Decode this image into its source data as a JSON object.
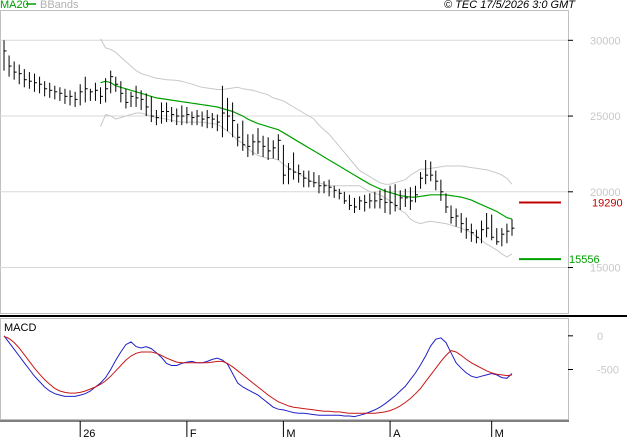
{
  "header": {
    "legend_ma": "MA20",
    "legend_bb": "BBands",
    "copyright": "© TEC 17/5/2026 3:0 GMT"
  },
  "colors": {
    "ma": "#00a000",
    "bbands": "#c8c8c8",
    "bars": "#000000",
    "grid": "#d8d8d8",
    "resistance": "#c00000",
    "support": "#00a000",
    "macd": "#2020c8",
    "signal": "#c81818"
  },
  "chart_data": [
    {
      "type": "line",
      "panel": "price",
      "ylim": [
        12000,
        32000
      ],
      "y_ticks": [
        15000,
        20000,
        25000,
        30000
      ],
      "y_tick_labels": [
        "15000",
        "20000",
        "25000",
        "30000"
      ],
      "x_ticks": [
        "26",
        "F",
        "M",
        "A",
        "M"
      ],
      "x_tick_index": [
        15,
        36,
        55,
        76,
        96
      ],
      "levels": [
        {
          "name": "resistance",
          "value": 19290,
          "label": "19290"
        },
        {
          "name": "support",
          "value": 15556,
          "label": "15556"
        }
      ],
      "ohlc": {
        "high": [
          30000,
          29000,
          28600,
          28400,
          28100,
          27900,
          27800,
          27600,
          27300,
          27200,
          27000,
          26900,
          26800,
          26700,
          26600,
          27100,
          27600,
          26800,
          27200,
          26900,
          27500,
          28000,
          27600,
          27300,
          26800,
          26600,
          27000,
          26700,
          26500,
          26300,
          25400,
          25900,
          25900,
          25600,
          25500,
          25700,
          25600,
          25300,
          25400,
          25300,
          25400,
          25200,
          25100,
          27000,
          26200,
          25900,
          24500,
          24700,
          23800,
          23800,
          24200,
          23700,
          23600,
          23400,
          23800,
          23100,
          21900,
          22600,
          21800,
          21400,
          21400,
          21300,
          21100,
          20700,
          20800,
          20400,
          20200,
          20000,
          19800,
          19600,
          19700,
          19800,
          19900,
          20000,
          20100,
          20200,
          20400,
          20500,
          20100,
          20200,
          20300,
          20400,
          21300,
          22100,
          22000,
          21400,
          20800,
          19900,
          19100,
          18900,
          18600,
          18300,
          17900,
          17500,
          18100,
          18600,
          18500,
          17600,
          17600,
          17900,
          18200
        ],
        "low": [
          28000,
          27600,
          27400,
          27100,
          26900,
          26800,
          26600,
          26500,
          26300,
          26200,
          26100,
          26000,
          25800,
          25700,
          25600,
          25700,
          25900,
          26000,
          26000,
          25800,
          25900,
          26500,
          26600,
          25900,
          25500,
          25600,
          25600,
          25400,
          25000,
          24600,
          24400,
          24500,
          24600,
          24600,
          24400,
          24400,
          24500,
          24400,
          24400,
          24300,
          24200,
          24200,
          24000,
          23600,
          24000,
          23600,
          23000,
          22700,
          22300,
          22400,
          22500,
          22300,
          22100,
          22200,
          22100,
          20500,
          20500,
          20800,
          20600,
          20300,
          20300,
          20300,
          19900,
          19900,
          19700,
          19600,
          19500,
          19200,
          18800,
          18600,
          18800,
          18700,
          18900,
          18900,
          18900,
          18600,
          18500,
          18700,
          18800,
          19000,
          18800,
          19300,
          20200,
          20500,
          20700,
          20100,
          19400,
          18600,
          17900,
          17700,
          17300,
          16900,
          16700,
          16600,
          16600,
          17000,
          16800,
          16500,
          16400,
          16600,
          17100
        ],
        "close": [
          29300,
          28300,
          27900,
          27800,
          27400,
          27300,
          27200,
          27100,
          26800,
          26700,
          26600,
          26500,
          26300,
          26300,
          26100,
          26600,
          26800,
          26600,
          26700,
          26300,
          26800,
          27600,
          27100,
          26500,
          25900,
          26300,
          26200,
          26100,
          25600,
          25000,
          24900,
          25300,
          25300,
          25100,
          25000,
          25000,
          25100,
          24900,
          25000,
          24800,
          24900,
          24800,
          24600,
          25200,
          25000,
          24700,
          23600,
          23100,
          23000,
          23300,
          23300,
          23000,
          22700,
          22900,
          23400,
          21100,
          21500,
          21300,
          21200,
          20900,
          20700,
          20600,
          20400,
          20400,
          20300,
          20100,
          19900,
          19400,
          19100,
          19000,
          19400,
          19300,
          19400,
          19400,
          19500,
          19300,
          19300,
          19100,
          19600,
          19600,
          19400,
          19800,
          20900,
          21100,
          21100,
          20700,
          20000,
          19000,
          18300,
          18400,
          17900,
          17500,
          17300,
          17000,
          17500,
          17600,
          17000,
          16700,
          17200,
          17400,
          17600
        ]
      },
      "ma20": [
        null,
        null,
        null,
        null,
        null,
        null,
        null,
        null,
        null,
        null,
        null,
        null,
        null,
        null,
        null,
        null,
        null,
        null,
        null,
        27200,
        27300,
        27200,
        27000,
        26900,
        26800,
        26700,
        26600,
        26500,
        26400,
        26300,
        26200,
        26150,
        26100,
        26050,
        26000,
        25950,
        25900,
        25850,
        25800,
        25750,
        25700,
        25650,
        25600,
        25500,
        25400,
        25300,
        25150,
        25000,
        24800,
        24650,
        24500,
        24400,
        24300,
        24200,
        24100,
        23900,
        23700,
        23500,
        23300,
        23100,
        22900,
        22700,
        22500,
        22300,
        22100,
        21900,
        21700,
        21500,
        21300,
        21100,
        20900,
        20700,
        20500,
        20350,
        20200,
        20050,
        19950,
        19850,
        19750,
        19700,
        19650,
        19650,
        19700,
        19750,
        19800,
        19800,
        19800,
        19800,
        19750,
        19700,
        19650,
        19550,
        19450,
        19300,
        19150,
        19000,
        18850,
        18700,
        18500,
        18300,
        18200
      ],
      "bb_upper": [
        null,
        null,
        null,
        null,
        null,
        null,
        null,
        null,
        null,
        null,
        null,
        null,
        null,
        null,
        null,
        null,
        null,
        null,
        null,
        30100,
        29500,
        29400,
        29200,
        28900,
        28600,
        28300,
        28000,
        27800,
        27700,
        27600,
        27500,
        27450,
        27400,
        27380,
        27350,
        27300,
        27200,
        27100,
        27000,
        26900,
        26850,
        26800,
        26750,
        26750,
        26800,
        26850,
        26900,
        26800,
        26750,
        26700,
        26600,
        26500,
        26400,
        26200,
        26100,
        26000,
        25800,
        25600,
        25400,
        25200,
        25000,
        24800,
        24400,
        24100,
        23800,
        23400,
        23000,
        22600,
        22200,
        21800,
        21400,
        21200,
        21000,
        20800,
        20600,
        20500,
        20500,
        20600,
        20700,
        20800,
        21100,
        21300,
        21500,
        21500,
        21550,
        21600,
        21650,
        21700,
        21700,
        21700,
        21700,
        21650,
        21600,
        21550,
        21500,
        21450,
        21350,
        21250,
        21100,
        20900,
        20500
      ],
      "bb_lower": [
        null,
        null,
        null,
        null,
        null,
        null,
        null,
        null,
        null,
        null,
        null,
        null,
        null,
        null,
        null,
        null,
        null,
        null,
        null,
        24300,
        25100,
        25000,
        24800,
        24900,
        25000,
        25100,
        25200,
        25200,
        25100,
        25000,
        24900,
        24850,
        24800,
        24720,
        24650,
        24600,
        24600,
        24600,
        24600,
        24600,
        24550,
        24500,
        24450,
        24250,
        24000,
        23750,
        23400,
        23200,
        22850,
        22600,
        22400,
        22300,
        22200,
        22200,
        22100,
        21800,
        21600,
        21400,
        21200,
        21000,
        20800,
        20600,
        20600,
        20500,
        20400,
        20400,
        20400,
        20400,
        20400,
        20400,
        20400,
        20200,
        20000,
        19900,
        19800,
        19600,
        19400,
        19100,
        18800,
        18600,
        18200,
        18000,
        17900,
        18000,
        18050,
        18000,
        17950,
        17900,
        17800,
        17700,
        17600,
        17450,
        17300,
        17050,
        16800,
        16550,
        16350,
        16150,
        15900,
        15700,
        15900
      ]
    },
    {
      "type": "line",
      "panel": "macd",
      "title": "MACD",
      "ylim": [
        -1250,
        250
      ],
      "y_ticks": [
        0,
        -500
      ],
      "y_tick_labels": [
        "0",
        "-500"
      ],
      "series": [
        {
          "name": "MACD",
          "values": [
            0,
            -100,
            -200,
            -300,
            -400,
            -500,
            -600,
            -680,
            -760,
            -820,
            -860,
            -880,
            -900,
            -900,
            -900,
            -880,
            -860,
            -820,
            -760,
            -700,
            -620,
            -500,
            -360,
            -240,
            -130,
            -90,
            -160,
            -180,
            -160,
            -190,
            -250,
            -320,
            -410,
            -440,
            -440,
            -410,
            -390,
            -380,
            -400,
            -400,
            -380,
            -350,
            -330,
            -360,
            -420,
            -560,
            -700,
            -760,
            -800,
            -840,
            -880,
            -940,
            -1000,
            -1060,
            -1090,
            -1100,
            -1120,
            -1140,
            -1150,
            -1150,
            -1160,
            -1170,
            -1180,
            -1180,
            -1180,
            -1180,
            -1180,
            -1190,
            -1190,
            -1200,
            -1180,
            -1160,
            -1130,
            -1100,
            -1060,
            -1010,
            -950,
            -890,
            -820,
            -750,
            -650,
            -550,
            -430,
            -300,
            -150,
            -50,
            -30,
            -100,
            -250,
            -400,
            -480,
            -550,
            -600,
            -620,
            -600,
            -580,
            -560,
            -580,
            -620,
            -630,
            -560
          ]
        },
        {
          "name": "Signal",
          "values": [
            -10,
            -40,
            -100,
            -180,
            -280,
            -380,
            -480,
            -570,
            -650,
            -720,
            -780,
            -820,
            -840,
            -850,
            -850,
            -840,
            -820,
            -790,
            -760,
            -720,
            -670,
            -600,
            -520,
            -440,
            -360,
            -300,
            -260,
            -240,
            -240,
            -240,
            -260,
            -290,
            -330,
            -360,
            -390,
            -400,
            -400,
            -400,
            -400,
            -400,
            -400,
            -390,
            -380,
            -380,
            -410,
            -460,
            -520,
            -580,
            -640,
            -700,
            -760,
            -820,
            -880,
            -930,
            -980,
            -1010,
            -1040,
            -1060,
            -1070,
            -1080,
            -1090,
            -1100,
            -1110,
            -1120,
            -1120,
            -1130,
            -1130,
            -1140,
            -1150,
            -1150,
            -1150,
            -1150,
            -1150,
            -1150,
            -1140,
            -1130,
            -1110,
            -1080,
            -1040,
            -990,
            -930,
            -860,
            -780,
            -680,
            -580,
            -480,
            -380,
            -290,
            -220,
            -240,
            -290,
            -350,
            -400,
            -440,
            -480,
            -520,
            -550,
            -570,
            -580,
            -590,
            -580
          ]
        }
      ]
    }
  ]
}
